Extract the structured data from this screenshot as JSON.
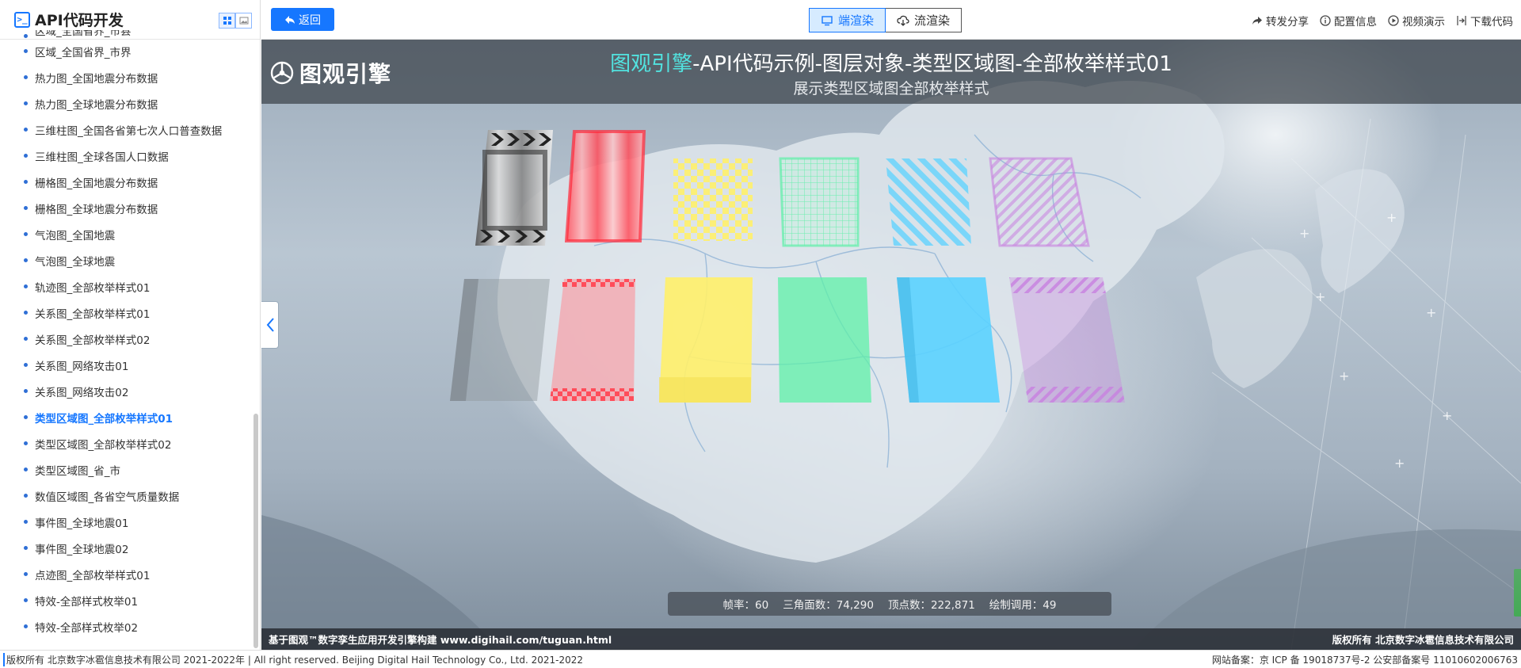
{
  "sidebar": {
    "title": "API代码开发",
    "clipped_item": "区域_全国省界_市县",
    "items": [
      {
        "label": "区域_全国省界_市界"
      },
      {
        "label": "热力图_全国地震分布数据"
      },
      {
        "label": "热力图_全球地震分布数据"
      },
      {
        "label": "三维柱图_全国各省第七次人口普查数据"
      },
      {
        "label": "三维柱图_全球各国人口数据"
      },
      {
        "label": "栅格图_全国地震分布数据"
      },
      {
        "label": "栅格图_全球地震分布数据"
      },
      {
        "label": "气泡图_全国地震"
      },
      {
        "label": "气泡图_全球地震"
      },
      {
        "label": "轨迹图_全部枚举样式01"
      },
      {
        "label": "关系图_全部枚举样式01"
      },
      {
        "label": "关系图_全部枚举样式02"
      },
      {
        "label": "关系图_网络攻击01"
      },
      {
        "label": "关系图_网络攻击02"
      },
      {
        "label": "类型区域图_全部枚举样式01",
        "active": true
      },
      {
        "label": "类型区域图_全部枚举样式02"
      },
      {
        "label": "类型区域图_省_市"
      },
      {
        "label": "数值区域图_各省空气质量数据"
      },
      {
        "label": "事件图_全球地震01"
      },
      {
        "label": "事件图_全球地震02"
      },
      {
        "label": "点迹图_全部枚举样式01"
      },
      {
        "label": "特效-全部样式枚举01"
      },
      {
        "label": "特效-全部样式枚举02"
      }
    ]
  },
  "toolbar": {
    "back_label": "返回",
    "render_client": "端渲染",
    "render_stream": "流渲染",
    "share": "转发分享",
    "config": "配置信息",
    "video": "视频演示",
    "download": "下载代码"
  },
  "viewport": {
    "brand": "图观引擎",
    "title_highlight": "图观引擎",
    "title_rest": "-API代码示例-图层对象-类型区域图-全部枚举样式01",
    "subtitle": "展示类型区域图全部枚举样式",
    "stats": {
      "fps_label": "帧率：",
      "fps": "60",
      "tri_label": "三角面数：",
      "tri": "74,290",
      "vert_label": "顶点数：",
      "vert": "222,871",
      "draw_label": "绘制调用：",
      "draw": "49"
    },
    "footer_left": "基于图观™数字孪生应用开发引擎构建 www.digihail.com/tuguan.html",
    "footer_right": "版权所有 北京数字冰雹信息技术有限公司"
  },
  "bottom": {
    "left": "版权所有 北京数字冰雹信息技术有限公司 2021-2022年 | All right reserved. Beijing Digital Hail Technology Co., Ltd. 2021-2022",
    "right": "网站备案：京 ICP 备 19018737号-2 公安部备案号 11010602006763"
  },
  "colors": {
    "accent": "#1677ff",
    "title_highlight": "#52e3e0",
    "box_gray": "#8f969c",
    "box_red": "#ff4d5a",
    "box_yellow": "#fff06a",
    "box_green": "#5ef0a8",
    "box_blue": "#5ad2ff",
    "box_purple": "#c880e0"
  }
}
